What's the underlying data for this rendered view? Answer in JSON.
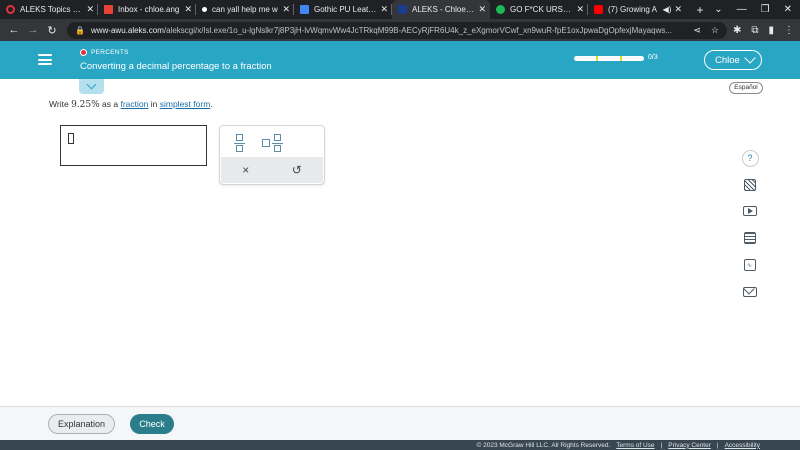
{
  "browser": {
    "tabs": [
      {
        "title": "ALEKS Topics 3/2",
        "favicon_color": "#e0343f",
        "active": false
      },
      {
        "title": "Inbox - chloe.ang",
        "favicon_color": "#ea4335",
        "active": false
      },
      {
        "title": "can yall help me w",
        "favicon_color": "#ffffff",
        "active": false
      },
      {
        "title": "Gothic PU Leather",
        "favicon_color": "#4285f4",
        "active": false
      },
      {
        "title": "ALEKS - Chloe An",
        "favicon_color": "#1a3d8f",
        "active": true
      },
      {
        "title": "GO F*CK URSELF",
        "favicon_color": "#1db954",
        "active": false
      },
      {
        "title": "(7) Growing A",
        "favicon_color": "#ff0000",
        "active": false
      }
    ],
    "new_tab": "+",
    "url_domain": "www-awu.aleks.com",
    "url_path": "/alekscgi/x/Isl.exe/1o_u-lgNslkr7j8P3jH-lvWqmvWw4JcTRkqM99B-AECyRjFR6U4k_z_eXgmorVCwf_xn9wuR-fpE1oxJpwaDgOpfexjMayaqws..."
  },
  "header": {
    "topic_category": "PERCENTS",
    "topic_title": "Converting a decimal percentage to a fraction",
    "progress_text": "0/3",
    "progress_fraction": 0,
    "user_name": "Chloe"
  },
  "language_button": "Español",
  "question": {
    "prefix": "Write",
    "number": "9.25%",
    "middle": "as a",
    "link1": "fraction",
    "in": "in",
    "link2": "simplest form",
    "suffix": "."
  },
  "keypad": {
    "clear_symbol": "×",
    "undo_symbol": "↺"
  },
  "side_tools": {
    "help": "?"
  },
  "footer": {
    "explanation_label": "Explanation",
    "check_label": "Check",
    "copyright": "© 2023 McGraw Hill LLC. All Rights Reserved.",
    "terms": "Terms of Use",
    "privacy": "Privacy Center",
    "accessibility": "Accessibility",
    "separator": "|"
  }
}
